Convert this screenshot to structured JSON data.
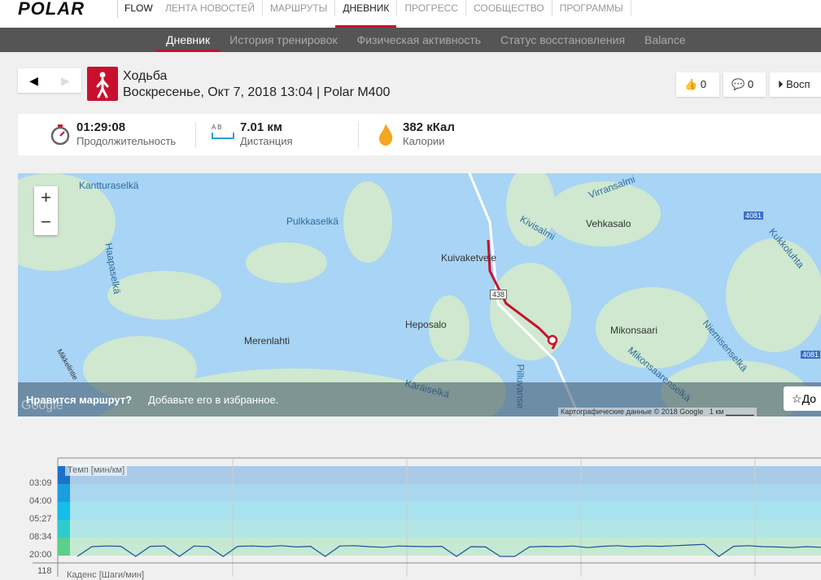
{
  "header": {
    "logo": "POLAR",
    "flow": "FLOW",
    "nav": [
      "ЛЕНТА НОВОСТЕЙ",
      "МАРШРУТЫ",
      "ДНЕВНИК",
      "ПРОГРЕСС",
      "СООБЩЕСТВО",
      "ПРОГРАММЫ"
    ],
    "active_nav": 2
  },
  "subnav": {
    "items": [
      "Дневник",
      "История тренировок",
      "Физическая активность",
      "Статус восстановления",
      "Balance"
    ],
    "active": 0
  },
  "session": {
    "sport": "Ходьба",
    "subtitle": "Воскресенье, Окт 7, 2018 13:04 | Polar M400",
    "likes": "0",
    "comments": "0",
    "replay": "Восп"
  },
  "stats": [
    {
      "value": "01:29:08",
      "label": "Продолжительность",
      "icon": "stopwatch-icon"
    },
    {
      "value": "7.01 км",
      "label": "Дистанция",
      "icon": "distance-icon",
      "icon_text": "A B"
    },
    {
      "value": "382 кКал",
      "label": "Калории",
      "icon": "flame-icon"
    }
  ],
  "map": {
    "labels": [
      "Kantturaselkä",
      "Pulkkaselkä",
      "Haapaselkä",
      "Merenlahti",
      "Heposalo",
      "Kuivaketvele",
      "Kivisalmi",
      "Virransalmi",
      "Vehkasalo",
      "Kukkoluhta",
      "Mikonsaari",
      "Niemisenselkä",
      "Mikonsaarenselkä",
      "Käräiselkä",
      "Pilluvanse",
      "Mikkelintie"
    ],
    "road_badges": [
      "4081",
      "4081",
      "438"
    ],
    "zoom_in": "+",
    "zoom_out": "−",
    "banner_bold": "Нравится маршрут?",
    "banner_text": "Добавьте его в избранное.",
    "favorite": "До",
    "credit": "Картографические данные © 2018 Google",
    "scale": "1 км",
    "google": "Google",
    "colors": {
      "water": "#a8d4f5",
      "land": "#cfe8cf",
      "route": "#c8102e"
    }
  },
  "chart_data": {
    "type": "line",
    "series_label": "Темп [мин/км]",
    "next_label": "Каденс [Шаги/мин]",
    "next_tick": "118",
    "yticks": [
      "03:09",
      "04:00",
      "05:27",
      "08:34",
      "20:00"
    ],
    "pace_values": [
      20,
      12.5,
      12.3,
      12.4,
      20,
      12.4,
      12.3,
      20,
      12.3,
      12.5,
      20,
      12.4,
      12.3,
      12.5,
      12.2,
      12.6,
      12.4,
      20,
      12.3,
      12.2,
      12.5,
      12.7,
      12.3,
      12.4,
      12.5,
      12.4,
      20,
      12.5,
      12.6,
      20,
      20,
      12.6,
      12.4,
      12.5,
      12.3,
      12.8,
      12.4,
      12.2,
      12.5,
      12.3,
      12.4,
      12.2,
      12.0,
      11.8,
      20,
      12.4,
      12.2,
      12.5,
      12.6,
      12.8,
      12.5,
      12.7
    ]
  }
}
